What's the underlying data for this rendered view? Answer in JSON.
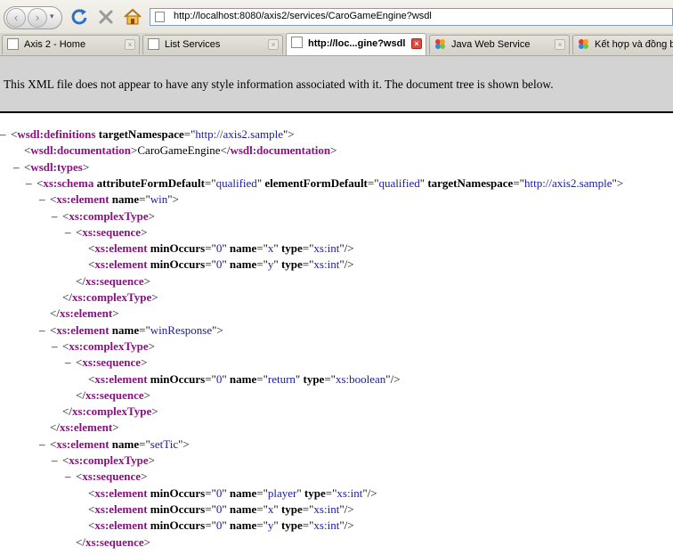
{
  "browser": {
    "url": "http://localhost:8080/axis2/services/CaroGameEngine?wsdl",
    "back_glyph": "‹",
    "forward_glyph": "›",
    "dropdown_glyph": "▾",
    "icons": [
      "back-icon",
      "forward-icon",
      "reload-icon",
      "stop-icon",
      "home-icon",
      "page-icon"
    ]
  },
  "tabs": [
    {
      "label": "Axis 2 - Home",
      "icon": "page-icon",
      "active": false
    },
    {
      "label": "List Services",
      "icon": "page-icon",
      "active": false
    },
    {
      "label": "http://loc...gine?wsdl",
      "icon": "page-icon",
      "active": true
    },
    {
      "label": "Java Web Service",
      "icon": "joomla-icon",
      "active": false
    },
    {
      "label": "Kết hợp và đồng bộ",
      "icon": "joomla-icon",
      "active": false
    }
  ],
  "banner": {
    "message": "This XML file does not appear to have any style information associated with it. The document tree is shown below."
  },
  "xml": {
    "toggle": "–",
    "lines": [
      {
        "indent": 0,
        "toggle": true,
        "parts": [
          [
            "p",
            "<"
          ],
          [
            "t",
            "wsdl:definitions"
          ],
          [
            "s",
            " "
          ],
          [
            "a",
            "targetNamespace"
          ],
          [
            "p",
            "=\""
          ],
          [
            "v",
            "http://axis2.sample"
          ],
          [
            "p",
            "\">"
          ]
        ]
      },
      {
        "indent": 1,
        "toggle": false,
        "parts": [
          [
            "p",
            "<"
          ],
          [
            "t",
            "wsdl:documentation"
          ],
          [
            "p",
            ">"
          ],
          [
            "x",
            "CaroGameEngine"
          ],
          [
            "p",
            "</"
          ],
          [
            "t",
            "wsdl:documentation"
          ],
          [
            "p",
            ">"
          ]
        ]
      },
      {
        "indent": 1,
        "toggle": true,
        "parts": [
          [
            "p",
            "<"
          ],
          [
            "t",
            "wsdl:types"
          ],
          [
            "p",
            ">"
          ]
        ]
      },
      {
        "indent": 2,
        "toggle": true,
        "parts": [
          [
            "p",
            "<"
          ],
          [
            "t",
            "xs:schema"
          ],
          [
            "s",
            " "
          ],
          [
            "a",
            "attributeFormDefault"
          ],
          [
            "p",
            "=\""
          ],
          [
            "v",
            "qualified"
          ],
          [
            "p",
            "\" "
          ],
          [
            "a",
            "elementFormDefault"
          ],
          [
            "p",
            "=\""
          ],
          [
            "v",
            "qualified"
          ],
          [
            "p",
            "\" "
          ],
          [
            "a",
            "targetNamespace"
          ],
          [
            "p",
            "=\""
          ],
          [
            "v",
            "http://axis2.sample"
          ],
          [
            "p",
            "\">"
          ]
        ]
      },
      {
        "indent": 3,
        "toggle": true,
        "parts": [
          [
            "p",
            "<"
          ],
          [
            "t",
            "xs:element"
          ],
          [
            "s",
            " "
          ],
          [
            "a",
            "name"
          ],
          [
            "p",
            "=\""
          ],
          [
            "v",
            "win"
          ],
          [
            "p",
            "\">"
          ]
        ]
      },
      {
        "indent": 4,
        "toggle": true,
        "parts": [
          [
            "p",
            "<"
          ],
          [
            "t",
            "xs:complexType"
          ],
          [
            "p",
            ">"
          ]
        ]
      },
      {
        "indent": 5,
        "toggle": true,
        "parts": [
          [
            "p",
            "<"
          ],
          [
            "t",
            "xs:sequence"
          ],
          [
            "p",
            ">"
          ]
        ]
      },
      {
        "indent": 6,
        "toggle": false,
        "parts": [
          [
            "p",
            "<"
          ],
          [
            "t",
            "xs:element"
          ],
          [
            "s",
            " "
          ],
          [
            "a",
            "minOccurs"
          ],
          [
            "p",
            "=\""
          ],
          [
            "v",
            "0"
          ],
          [
            "p",
            "\" "
          ],
          [
            "a",
            "name"
          ],
          [
            "p",
            "=\""
          ],
          [
            "v",
            "x"
          ],
          [
            "p",
            "\" "
          ],
          [
            "a",
            "type"
          ],
          [
            "p",
            "=\""
          ],
          [
            "v",
            "xs:int"
          ],
          [
            "p",
            "\"/>"
          ]
        ]
      },
      {
        "indent": 6,
        "toggle": false,
        "parts": [
          [
            "p",
            "<"
          ],
          [
            "t",
            "xs:element"
          ],
          [
            "s",
            " "
          ],
          [
            "a",
            "minOccurs"
          ],
          [
            "p",
            "=\""
          ],
          [
            "v",
            "0"
          ],
          [
            "p",
            "\" "
          ],
          [
            "a",
            "name"
          ],
          [
            "p",
            "=\""
          ],
          [
            "v",
            "y"
          ],
          [
            "p",
            "\" "
          ],
          [
            "a",
            "type"
          ],
          [
            "p",
            "=\""
          ],
          [
            "v",
            "xs:int"
          ],
          [
            "p",
            "\"/>"
          ]
        ]
      },
      {
        "indent": 5,
        "toggle": false,
        "parts": [
          [
            "p",
            "</"
          ],
          [
            "t",
            "xs:sequence"
          ],
          [
            "p",
            ">"
          ]
        ]
      },
      {
        "indent": 4,
        "toggle": false,
        "parts": [
          [
            "p",
            "</"
          ],
          [
            "t",
            "xs:complexType"
          ],
          [
            "p",
            ">"
          ]
        ]
      },
      {
        "indent": 3,
        "toggle": false,
        "parts": [
          [
            "p",
            "</"
          ],
          [
            "t",
            "xs:element"
          ],
          [
            "p",
            ">"
          ]
        ]
      },
      {
        "indent": 3,
        "toggle": true,
        "parts": [
          [
            "p",
            "<"
          ],
          [
            "t",
            "xs:element"
          ],
          [
            "s",
            " "
          ],
          [
            "a",
            "name"
          ],
          [
            "p",
            "=\""
          ],
          [
            "v",
            "winResponse"
          ],
          [
            "p",
            "\">"
          ]
        ]
      },
      {
        "indent": 4,
        "toggle": true,
        "parts": [
          [
            "p",
            "<"
          ],
          [
            "t",
            "xs:complexType"
          ],
          [
            "p",
            ">"
          ]
        ]
      },
      {
        "indent": 5,
        "toggle": true,
        "parts": [
          [
            "p",
            "<"
          ],
          [
            "t",
            "xs:sequence"
          ],
          [
            "p",
            ">"
          ]
        ]
      },
      {
        "indent": 6,
        "toggle": false,
        "parts": [
          [
            "p",
            "<"
          ],
          [
            "t",
            "xs:element"
          ],
          [
            "s",
            " "
          ],
          [
            "a",
            "minOccurs"
          ],
          [
            "p",
            "=\""
          ],
          [
            "v",
            "0"
          ],
          [
            "p",
            "\" "
          ],
          [
            "a",
            "name"
          ],
          [
            "p",
            "=\""
          ],
          [
            "v",
            "return"
          ],
          [
            "p",
            "\" "
          ],
          [
            "a",
            "type"
          ],
          [
            "p",
            "=\""
          ],
          [
            "v",
            "xs:boolean"
          ],
          [
            "p",
            "\"/>"
          ]
        ]
      },
      {
        "indent": 5,
        "toggle": false,
        "parts": [
          [
            "p",
            "</"
          ],
          [
            "t",
            "xs:sequence"
          ],
          [
            "p",
            ">"
          ]
        ]
      },
      {
        "indent": 4,
        "toggle": false,
        "parts": [
          [
            "p",
            "</"
          ],
          [
            "t",
            "xs:complexType"
          ],
          [
            "p",
            ">"
          ]
        ]
      },
      {
        "indent": 3,
        "toggle": false,
        "parts": [
          [
            "p",
            "</"
          ],
          [
            "t",
            "xs:element"
          ],
          [
            "p",
            ">"
          ]
        ]
      },
      {
        "indent": 3,
        "toggle": true,
        "parts": [
          [
            "p",
            "<"
          ],
          [
            "t",
            "xs:element"
          ],
          [
            "s",
            " "
          ],
          [
            "a",
            "name"
          ],
          [
            "p",
            "=\""
          ],
          [
            "v",
            "setTic"
          ],
          [
            "p",
            "\">"
          ]
        ]
      },
      {
        "indent": 4,
        "toggle": true,
        "parts": [
          [
            "p",
            "<"
          ],
          [
            "t",
            "xs:complexType"
          ],
          [
            "p",
            ">"
          ]
        ]
      },
      {
        "indent": 5,
        "toggle": true,
        "parts": [
          [
            "p",
            "<"
          ],
          [
            "t",
            "xs:sequence"
          ],
          [
            "p",
            ">"
          ]
        ]
      },
      {
        "indent": 6,
        "toggle": false,
        "parts": [
          [
            "p",
            "<"
          ],
          [
            "t",
            "xs:element"
          ],
          [
            "s",
            " "
          ],
          [
            "a",
            "minOccurs"
          ],
          [
            "p",
            "=\""
          ],
          [
            "v",
            "0"
          ],
          [
            "p",
            "\" "
          ],
          [
            "a",
            "name"
          ],
          [
            "p",
            "=\""
          ],
          [
            "v",
            "player"
          ],
          [
            "p",
            "\" "
          ],
          [
            "a",
            "type"
          ],
          [
            "p",
            "=\""
          ],
          [
            "v",
            "xs:int"
          ],
          [
            "p",
            "\"/>"
          ]
        ]
      },
      {
        "indent": 6,
        "toggle": false,
        "parts": [
          [
            "p",
            "<"
          ],
          [
            "t",
            "xs:element"
          ],
          [
            "s",
            " "
          ],
          [
            "a",
            "minOccurs"
          ],
          [
            "p",
            "=\""
          ],
          [
            "v",
            "0"
          ],
          [
            "p",
            "\" "
          ],
          [
            "a",
            "name"
          ],
          [
            "p",
            "=\""
          ],
          [
            "v",
            "x"
          ],
          [
            "p",
            "\" "
          ],
          [
            "a",
            "type"
          ],
          [
            "p",
            "=\""
          ],
          [
            "v",
            "xs:int"
          ],
          [
            "p",
            "\"/>"
          ]
        ]
      },
      {
        "indent": 6,
        "toggle": false,
        "parts": [
          [
            "p",
            "<"
          ],
          [
            "t",
            "xs:element"
          ],
          [
            "s",
            " "
          ],
          [
            "a",
            "minOccurs"
          ],
          [
            "p",
            "=\""
          ],
          [
            "v",
            "0"
          ],
          [
            "p",
            "\" "
          ],
          [
            "a",
            "name"
          ],
          [
            "p",
            "=\""
          ],
          [
            "v",
            "y"
          ],
          [
            "p",
            "\" "
          ],
          [
            "a",
            "type"
          ],
          [
            "p",
            "=\""
          ],
          [
            "v",
            "xs:int"
          ],
          [
            "p",
            "\"/>"
          ]
        ]
      },
      {
        "indent": 5,
        "toggle": false,
        "parts": [
          [
            "p",
            "</"
          ],
          [
            "t",
            "xs:sequence"
          ],
          [
            "p",
            ">"
          ]
        ]
      }
    ]
  }
}
